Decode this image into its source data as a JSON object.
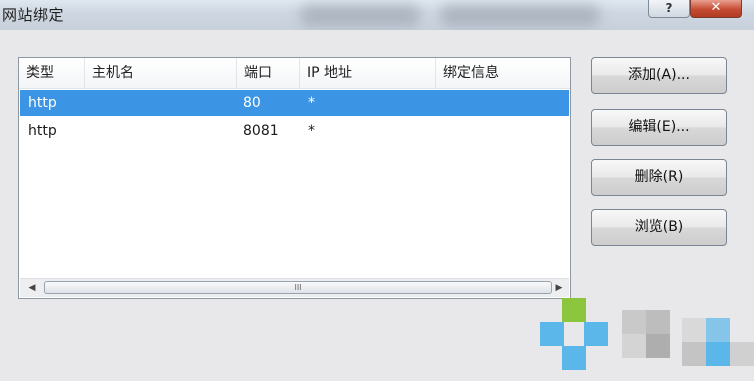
{
  "window": {
    "title": "网站绑定",
    "help_label": "?",
    "close_label": "✕"
  },
  "bindings_table": {
    "columns": [
      "类型",
      "主机名",
      "端口",
      "IP 地址",
      "绑定信息"
    ],
    "rows": [
      {
        "type": "http",
        "host": "",
        "port": "80",
        "ip": "*",
        "info": "",
        "selected": true
      },
      {
        "type": "http",
        "host": "",
        "port": "8081",
        "ip": "*",
        "info": "",
        "selected": false
      }
    ]
  },
  "scrollbar": {
    "left_arrow": "◀",
    "right_arrow": "▶",
    "grip": "III"
  },
  "buttons": {
    "add": "添加(A)...",
    "edit": "编辑(E)...",
    "remove": "删除(R)",
    "browse": "浏览(B)"
  },
  "colors": {
    "selection": "#3c94e4",
    "watermark_green": "#8cc63f",
    "watermark_blue": "#5bb7ea"
  }
}
